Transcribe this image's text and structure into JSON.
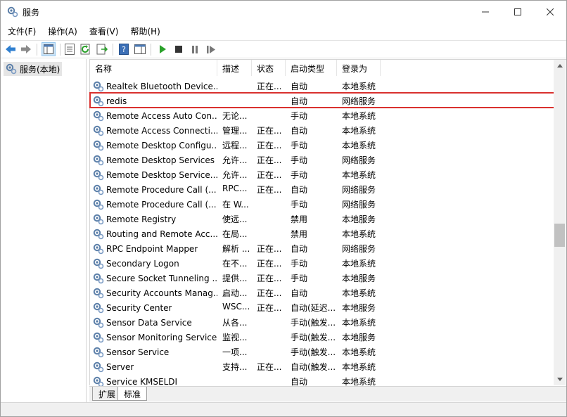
{
  "window": {
    "title": "服务"
  },
  "menu": {
    "items": [
      "文件(F)",
      "操作(A)",
      "查看(V)",
      "帮助(H)"
    ]
  },
  "toolbar": {
    "buttons": [
      "back-icon",
      "forward-icon",
      "show-hide-console-tree-icon",
      "properties-icon",
      "refresh-icon",
      "export-list-icon",
      "help-icon",
      "show-action-pane-icon",
      "start-service-icon",
      "stop-service-icon",
      "pause-service-icon",
      "restart-service-icon"
    ]
  },
  "tree": {
    "root": "服务(本地)"
  },
  "columns": {
    "name": "名称",
    "desc": "描述",
    "status": "状态",
    "startup": "启动类型",
    "logon": "登录为"
  },
  "rows": [
    {
      "name": "Realtek Bluetooth Device...",
      "desc": "",
      "status": "正在...",
      "startup": "自动",
      "logon": "本地系统"
    },
    {
      "name": "redis",
      "desc": "",
      "status": "",
      "startup": "自动",
      "logon": "网络服务"
    },
    {
      "name": "Remote Access Auto Con...",
      "desc": "无论...",
      "status": "",
      "startup": "手动",
      "logon": "本地系统"
    },
    {
      "name": "Remote Access Connecti...",
      "desc": "管理...",
      "status": "正在...",
      "startup": "自动",
      "logon": "本地系统"
    },
    {
      "name": "Remote Desktop Configu...",
      "desc": "远程...",
      "status": "正在...",
      "startup": "手动",
      "logon": "本地系统"
    },
    {
      "name": "Remote Desktop Services",
      "desc": "允许...",
      "status": "正在...",
      "startup": "手动",
      "logon": "网络服务"
    },
    {
      "name": "Remote Desktop Service...",
      "desc": "允许...",
      "status": "正在...",
      "startup": "手动",
      "logon": "本地系统"
    },
    {
      "name": "Remote Procedure Call (...",
      "desc": "RPC...",
      "status": "正在...",
      "startup": "自动",
      "logon": "网络服务"
    },
    {
      "name": "Remote Procedure Call (...",
      "desc": "在 W...",
      "status": "",
      "startup": "手动",
      "logon": "网络服务"
    },
    {
      "name": "Remote Registry",
      "desc": "使远...",
      "status": "",
      "startup": "禁用",
      "logon": "本地服务"
    },
    {
      "name": "Routing and Remote Acc...",
      "desc": "在局...",
      "status": "",
      "startup": "禁用",
      "logon": "本地系统"
    },
    {
      "name": "RPC Endpoint Mapper",
      "desc": "解析 ...",
      "status": "正在...",
      "startup": "自动",
      "logon": "网络服务"
    },
    {
      "name": "Secondary Logon",
      "desc": "在不...",
      "status": "正在...",
      "startup": "手动",
      "logon": "本地系统"
    },
    {
      "name": "Secure Socket Tunneling ...",
      "desc": "提供...",
      "status": "正在...",
      "startup": "手动",
      "logon": "本地服务"
    },
    {
      "name": "Security Accounts Manag...",
      "desc": "启动...",
      "status": "正在...",
      "startup": "自动",
      "logon": "本地系统"
    },
    {
      "name": "Security Center",
      "desc": "WSC...",
      "status": "正在...",
      "startup": "自动(延迟...",
      "logon": "本地服务"
    },
    {
      "name": "Sensor Data Service",
      "desc": "从各...",
      "status": "",
      "startup": "手动(触发...",
      "logon": "本地系统"
    },
    {
      "name": "Sensor Monitoring Service",
      "desc": "监视...",
      "status": "",
      "startup": "手动(触发...",
      "logon": "本地服务"
    },
    {
      "name": "Sensor Service",
      "desc": "一项...",
      "status": "",
      "startup": "手动(触发...",
      "logon": "本地系统"
    },
    {
      "name": "Server",
      "desc": "支持...",
      "status": "正在...",
      "startup": "自动(触发...",
      "logon": "本地系统"
    },
    {
      "name": "Service KMSELDI",
      "desc": "",
      "status": "",
      "startup": "自动",
      "logon": "本地系统"
    }
  ],
  "tabs": {
    "extended": "扩展",
    "standard": "标准"
  },
  "colors": {
    "highlight_border": "#d9312e",
    "toolbar_arrow": "#2f7fd0",
    "play_green": "#2aa12a"
  }
}
